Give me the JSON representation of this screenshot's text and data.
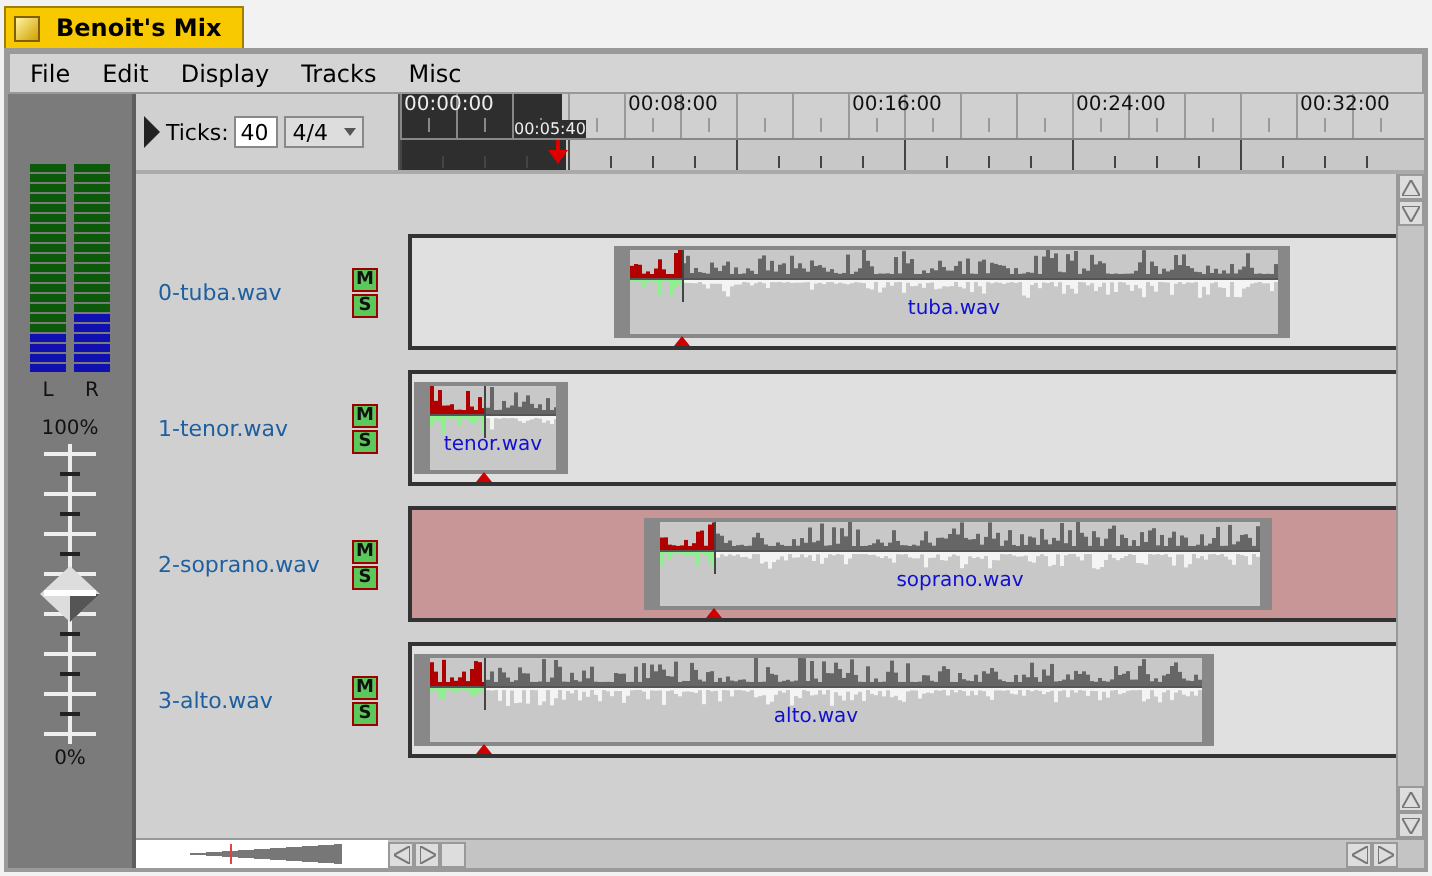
{
  "window": {
    "title": "Benoit's Mix"
  },
  "menu": [
    "File",
    "Edit",
    "Display",
    "Tracks",
    "Misc"
  ],
  "toolbar": {
    "ticks_label": "Ticks:",
    "ticks": "40",
    "meter": "4/4"
  },
  "ruler": {
    "labels": [
      "00:00:00",
      "00:08:00",
      "00:16:00",
      "00:24:00",
      "00:32:00"
    ],
    "cursor_time": "00:05:40"
  },
  "meters": [
    {
      "label": "L",
      "level": 0.19
    },
    {
      "label": "R",
      "level": 0.29
    }
  ],
  "volume": {
    "max_label": "100%",
    "min_label": "0%",
    "level": 0.5
  },
  "zoom": {
    "level": 0.3
  },
  "tracks": [
    {
      "name": "0-tuba.wav",
      "selected": false,
      "mute": "M",
      "solo": "S",
      "clip": "tuba.wav"
    },
    {
      "name": "1-tenor.wav",
      "selected": false,
      "mute": "M",
      "solo": "S",
      "clip": "tenor.wav"
    },
    {
      "name": "2-soprano.wav",
      "selected": true,
      "mute": "M",
      "solo": "S",
      "clip": "soprano.wav"
    },
    {
      "name": "3-alto.wav",
      "selected": false,
      "mute": "M",
      "solo": "S",
      "clip": "alto.wav"
    }
  ]
}
